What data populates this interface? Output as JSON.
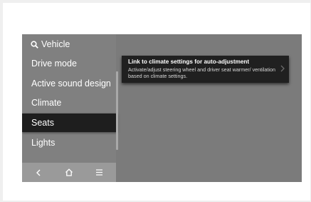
{
  "search": {
    "label": "Vehicle"
  },
  "menu": {
    "items": [
      {
        "label": "Drive mode"
      },
      {
        "label": "Active sound design"
      },
      {
        "label": "Climate"
      },
      {
        "label": "Seats",
        "selected": true
      },
      {
        "label": "Lights"
      }
    ]
  },
  "card": {
    "title": "Link to climate settings for auto-adjustment",
    "description": "Activate/adjust steering wheel and driver seat warmer/ ventilation based on climate settings."
  },
  "bottom_bar": {
    "icons": [
      "back-icon",
      "home-icon",
      "menu-icon"
    ]
  },
  "colors": {
    "screen_bg": "#7b7b7b",
    "selected_bg": "#1e1e1e",
    "bottom_bar_bg": "#9a9a9a"
  }
}
